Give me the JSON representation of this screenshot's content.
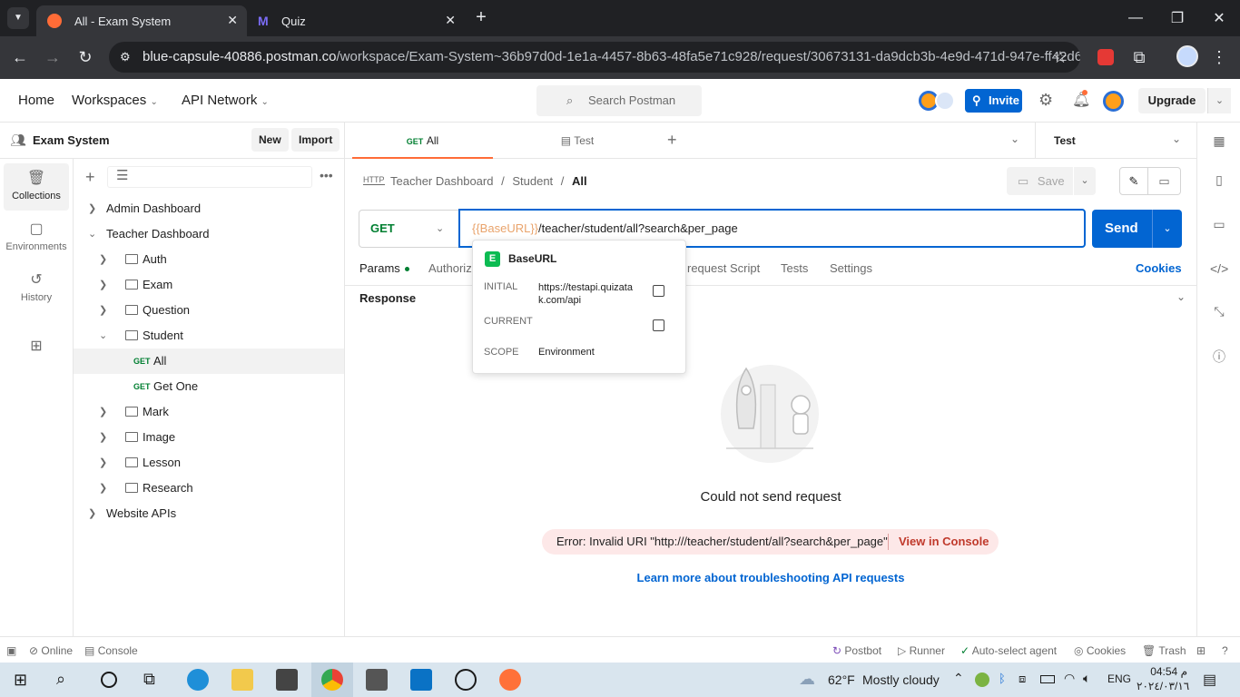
{
  "browser": {
    "tabs": [
      {
        "title": "All - Exam System",
        "active": true
      },
      {
        "title": "Quiz",
        "active": false
      }
    ],
    "url_host": "blue-capsule-40886.postman.co",
    "url_path": "/workspace/Exam-System~36b97d0d-1e1a-4457-8b63-48fa5e71c928/request/30673131-da9dcb3b-4e9d-471d-947e-ff42d613..."
  },
  "header": {
    "home": "Home",
    "workspaces": "Workspaces",
    "api_network": "API Network",
    "search_placeholder": "Search Postman",
    "invite": "Invite",
    "upgrade": "Upgrade"
  },
  "sidebar": {
    "workspace_name": "Exam System",
    "new_label": "New",
    "import_label": "Import",
    "rail": [
      {
        "label": "Collections",
        "icon": "collections-icon",
        "selected": true
      },
      {
        "label": "Environments",
        "icon": "environments-icon",
        "selected": false
      },
      {
        "label": "History",
        "icon": "history-icon",
        "selected": false
      },
      {
        "label": "",
        "icon": "configure-workbench-icon",
        "selected": false
      }
    ],
    "tree": [
      {
        "label": "Admin Dashboard",
        "level": 0,
        "kind": "collection",
        "expanded": false
      },
      {
        "label": "Teacher Dashboard",
        "level": 0,
        "kind": "collection",
        "expanded": true
      },
      {
        "label": "Auth",
        "level": 1,
        "kind": "folder",
        "expanded": false
      },
      {
        "label": "Exam",
        "level": 1,
        "kind": "folder",
        "expanded": false
      },
      {
        "label": "Question",
        "level": 1,
        "kind": "folder",
        "expanded": false
      },
      {
        "label": "Student",
        "level": 1,
        "kind": "folder",
        "expanded": true
      },
      {
        "label": "All",
        "level": 2,
        "kind": "request",
        "method": "GET",
        "selected": true
      },
      {
        "label": "Get One",
        "level": 2,
        "kind": "request",
        "method": "GET"
      },
      {
        "label": "Mark",
        "level": 1,
        "kind": "folder",
        "expanded": false
      },
      {
        "label": "Image",
        "level": 1,
        "kind": "folder",
        "expanded": false
      },
      {
        "label": "Lesson",
        "level": 1,
        "kind": "folder",
        "expanded": false
      },
      {
        "label": "Research",
        "level": 1,
        "kind": "folder",
        "expanded": false
      },
      {
        "label": "Website APIs",
        "level": 0,
        "kind": "collection",
        "expanded": false
      }
    ]
  },
  "request_tabs": [
    {
      "method": "GET",
      "label": "All",
      "active": true
    },
    {
      "method": "",
      "label": "Test",
      "active": false
    }
  ],
  "environment": "Test",
  "breadcrumb": [
    "Teacher Dashboard",
    "Student",
    "All"
  ],
  "save_label": "Save",
  "request": {
    "method": "GET",
    "url_var": "{{BaseURL}}",
    "url_rest": "/teacher/student/all?search&per_page",
    "send": "Send"
  },
  "subtabs": [
    "Params",
    "Authoriz",
    "Pre-request Script",
    "Tests",
    "Settings"
  ],
  "subtab_visible_fragment": "request Script",
  "cookies": "Cookies",
  "response_label": "Response",
  "var_popup": {
    "badge": "E",
    "name": "BaseURL",
    "initial_label": "INITIAL",
    "initial_value": "https://testapi.quizatak.com/api",
    "current_label": "CURRENT",
    "current_value": "",
    "scope_label": "SCOPE",
    "scope_value": "Environment"
  },
  "error": {
    "title": "Could not send request",
    "message": "Error: Invalid URI \"http:///teacher/student/all?search&per_page\"",
    "console_link": "View in Console",
    "learn_more": "Learn more about troubleshooting API requests"
  },
  "statusbar": {
    "online": "Online",
    "console": "Console",
    "postbot": "Postbot",
    "runner": "Runner",
    "agent": "Auto-select agent",
    "cookies": "Cookies",
    "trash": "Trash"
  },
  "taskbar": {
    "weather_temp": "62°F",
    "weather_desc": "Mostly cloudy",
    "lang": "ENG",
    "time": "04:54 م",
    "date": "٢٠٢٤/٠٣/١٦"
  },
  "colors": {
    "accent": "#0265d2",
    "get_method": "#007f31",
    "var_orange": "#e9a36b",
    "error_red": "#c0392b"
  }
}
